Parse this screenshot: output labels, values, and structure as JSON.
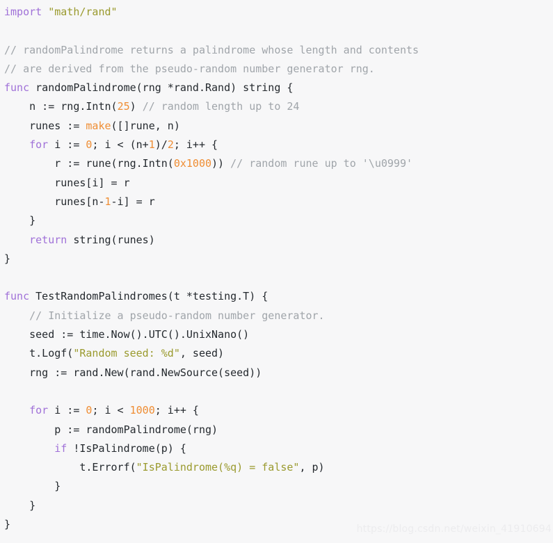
{
  "editor": {
    "language": "go",
    "background_color": "#f7f7f8",
    "default_text_color": "#24292e",
    "colors": {
      "keyword": "#a071d8",
      "string": "#9a9a2e",
      "number": "#ef8d33",
      "builtin_function": "#ef8d33",
      "comment": "#a0a5aa"
    }
  },
  "watermark": {
    "text": "https://blog.csdn.net/weixin_41910694"
  },
  "code": {
    "lines": [
      {
        "tokens": [
          {
            "t": "import",
            "c": "kw"
          },
          {
            "t": " ",
            "c": "plain"
          },
          {
            "t": "\"math/rand\"",
            "c": "str"
          }
        ]
      },
      {
        "tokens": []
      },
      {
        "tokens": [
          {
            "t": "// randomPalindrome returns a palindrome whose length and contents",
            "c": "com"
          }
        ]
      },
      {
        "tokens": [
          {
            "t": "// are derived from the pseudo-random number generator rng.",
            "c": "com"
          }
        ]
      },
      {
        "tokens": [
          {
            "t": "func",
            "c": "kw"
          },
          {
            "t": " randomPalindrome(rng *rand.Rand) ",
            "c": "plain"
          },
          {
            "t": "string",
            "c": "plain"
          },
          {
            "t": " {",
            "c": "plain"
          }
        ]
      },
      {
        "tokens": [
          {
            "t": "    n := rng.Intn(",
            "c": "plain"
          },
          {
            "t": "25",
            "c": "num"
          },
          {
            "t": ") ",
            "c": "plain"
          },
          {
            "t": "// random length up to 24",
            "c": "com"
          }
        ]
      },
      {
        "tokens": [
          {
            "t": "    runes := ",
            "c": "plain"
          },
          {
            "t": "make",
            "c": "fn"
          },
          {
            "t": "([]rune, n)",
            "c": "plain"
          }
        ]
      },
      {
        "tokens": [
          {
            "t": "    ",
            "c": "plain"
          },
          {
            "t": "for",
            "c": "kw"
          },
          {
            "t": " i := ",
            "c": "plain"
          },
          {
            "t": "0",
            "c": "num"
          },
          {
            "t": "; i < (n+",
            "c": "plain"
          },
          {
            "t": "1",
            "c": "num"
          },
          {
            "t": ")/",
            "c": "plain"
          },
          {
            "t": "2",
            "c": "num"
          },
          {
            "t": "; i++ {",
            "c": "plain"
          }
        ]
      },
      {
        "tokens": [
          {
            "t": "        r := rune(rng.Intn(",
            "c": "plain"
          },
          {
            "t": "0x1000",
            "c": "num"
          },
          {
            "t": ")) ",
            "c": "plain"
          },
          {
            "t": "// random rune up to '\\u0999'",
            "c": "com"
          }
        ]
      },
      {
        "tokens": [
          {
            "t": "        runes[i] = r",
            "c": "plain"
          }
        ]
      },
      {
        "tokens": [
          {
            "t": "        runes[n-",
            "c": "plain"
          },
          {
            "t": "1",
            "c": "num"
          },
          {
            "t": "-i] = r",
            "c": "plain"
          }
        ]
      },
      {
        "tokens": [
          {
            "t": "    }",
            "c": "plain"
          }
        ]
      },
      {
        "tokens": [
          {
            "t": "    ",
            "c": "plain"
          },
          {
            "t": "return",
            "c": "kw"
          },
          {
            "t": " string(runes)",
            "c": "plain"
          }
        ]
      },
      {
        "tokens": [
          {
            "t": "}",
            "c": "plain"
          }
        ]
      },
      {
        "tokens": []
      },
      {
        "tokens": [
          {
            "t": "func",
            "c": "kw"
          },
          {
            "t": " TestRandomPalindromes(t *testing.T) {",
            "c": "plain"
          }
        ]
      },
      {
        "tokens": [
          {
            "t": "    ",
            "c": "plain"
          },
          {
            "t": "// Initialize a pseudo-random number generator.",
            "c": "com"
          }
        ]
      },
      {
        "tokens": [
          {
            "t": "    seed := time.Now().UTC().UnixNano()",
            "c": "plain"
          }
        ]
      },
      {
        "tokens": [
          {
            "t": "    t.Logf(",
            "c": "plain"
          },
          {
            "t": "\"Random seed: %d\"",
            "c": "str"
          },
          {
            "t": ", seed)",
            "c": "plain"
          }
        ]
      },
      {
        "tokens": [
          {
            "t": "    rng := rand.New(rand.NewSource(seed))",
            "c": "plain"
          }
        ]
      },
      {
        "tokens": []
      },
      {
        "tokens": [
          {
            "t": "    ",
            "c": "plain"
          },
          {
            "t": "for",
            "c": "kw"
          },
          {
            "t": " i := ",
            "c": "plain"
          },
          {
            "t": "0",
            "c": "num"
          },
          {
            "t": "; i < ",
            "c": "plain"
          },
          {
            "t": "1000",
            "c": "num"
          },
          {
            "t": "; i++ {",
            "c": "plain"
          }
        ]
      },
      {
        "tokens": [
          {
            "t": "        p := randomPalindrome(rng)",
            "c": "plain"
          }
        ]
      },
      {
        "tokens": [
          {
            "t": "        ",
            "c": "plain"
          },
          {
            "t": "if",
            "c": "kw"
          },
          {
            "t": " !IsPalindrome(p) {",
            "c": "plain"
          }
        ]
      },
      {
        "tokens": [
          {
            "t": "            t.Errorf(",
            "c": "plain"
          },
          {
            "t": "\"IsPalindrome(%q) = false\"",
            "c": "str"
          },
          {
            "t": ", p)",
            "c": "plain"
          }
        ]
      },
      {
        "tokens": [
          {
            "t": "        }",
            "c": "plain"
          }
        ]
      },
      {
        "tokens": [
          {
            "t": "    }",
            "c": "plain"
          }
        ]
      },
      {
        "tokens": [
          {
            "t": "}",
            "c": "plain"
          }
        ]
      }
    ]
  }
}
